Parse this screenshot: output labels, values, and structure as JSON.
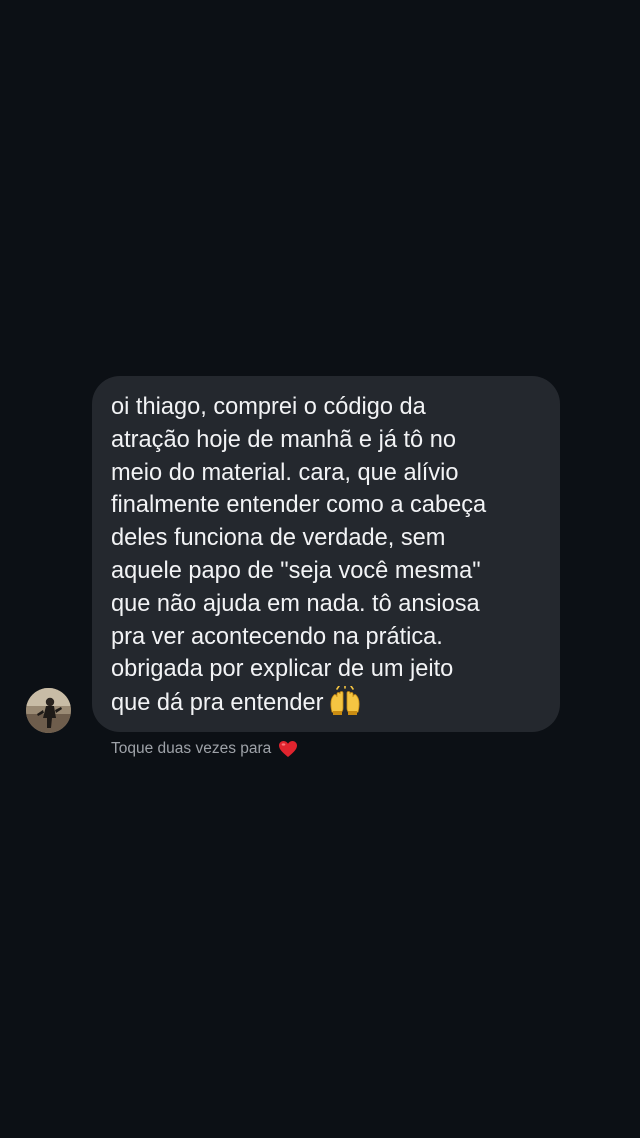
{
  "message": {
    "text": "oi thiago, comprei o código da\natração hoje de manhã e já tô no\nmeio do material. cara, que alívio\nfinalmente entender como a cabeça\ndeles funciona de verdade, sem\naquele papo de \"seja você mesma\"\nque não ajuda em nada. tô ansiosa\npra ver acontecendo na prática.\nobrigada por explicar de um jeito\nque dá pra entender",
    "emoji": "🙌"
  },
  "hint": {
    "label": "Toque duas vezes para",
    "emoji": "❤️"
  },
  "colors": {
    "background": "#0c1015",
    "bubble": "#24282e",
    "text": "#f2f3f5",
    "hint_text": "#9ea2a8",
    "heart": "#e0242e"
  },
  "icons": {
    "avatar": "sender-avatar",
    "message_emoji": "raising-hands-icon",
    "hint_emoji": "heart-icon"
  }
}
